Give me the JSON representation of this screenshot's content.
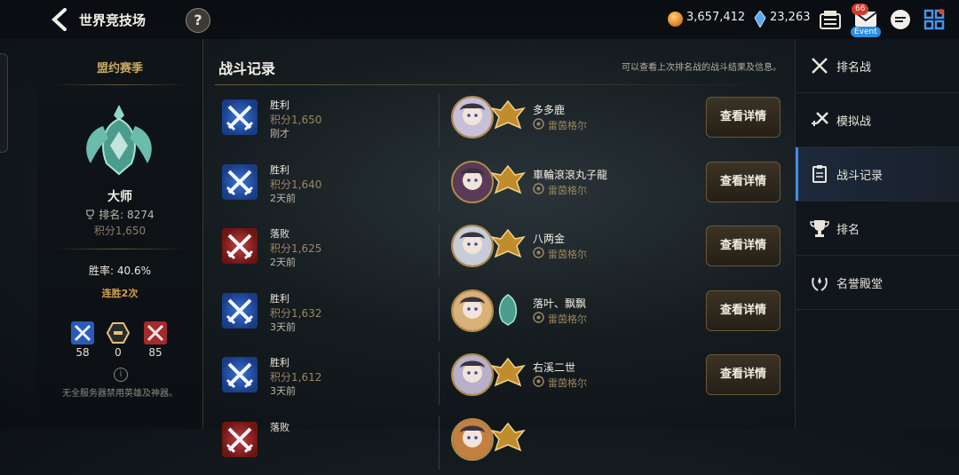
{
  "header": {
    "title": "世界竞技场",
    "help": "?",
    "gold": "3,657,412",
    "crystal": "23,263",
    "mail_badge": "66",
    "event_label": "Event"
  },
  "left": {
    "season": "盟约赛季",
    "tier": "大师",
    "rank": "排名: 8274",
    "score": "积分1,650",
    "winrate": "胜率: 40.6%",
    "streak": "连胜2次",
    "wins": "58",
    "draws": "0",
    "losses": "85",
    "note": "无全服务器禁用英雄及神器。"
  },
  "main": {
    "title": "战斗记录",
    "hint": "可以查看上次排名战的战斗结果及信息。",
    "detail_label": "查看详情",
    "records": [
      {
        "result": "胜利",
        "score": "积分1,650",
        "time": "刚才",
        "opponent": "多多鹿",
        "server": "雷茵格尔",
        "win": true
      },
      {
        "result": "胜利",
        "score": "积分1,640",
        "time": "2天前",
        "opponent": "車輪滾滾丸子龍",
        "server": "雷茵格尔",
        "win": true
      },
      {
        "result": "落败",
        "score": "积分1,625",
        "time": "2天前",
        "opponent": "八两金",
        "server": "雷茵格尔",
        "win": false
      },
      {
        "result": "胜利",
        "score": "积分1,632",
        "time": "3天前",
        "opponent": "落叶、飘飘",
        "server": "雷茵格尔",
        "win": true
      },
      {
        "result": "胜利",
        "score": "积分1,612",
        "time": "3天前",
        "opponent": "右溪二世",
        "server": "雷茵格尔",
        "win": true
      },
      {
        "result": "落败",
        "score": "",
        "time": "",
        "opponent": "",
        "server": "",
        "win": false
      }
    ]
  },
  "menu": {
    "items": [
      {
        "label": "排名战"
      },
      {
        "label": "模拟战"
      },
      {
        "label": "战斗记录"
      },
      {
        "label": "排名"
      },
      {
        "label": "名誉殿堂"
      }
    ]
  },
  "colors": {
    "accent_blue": "#3f8ce6",
    "gold_text": "#c9a862",
    "win_blue": "#2f66c8",
    "loss_red": "#b83434"
  }
}
